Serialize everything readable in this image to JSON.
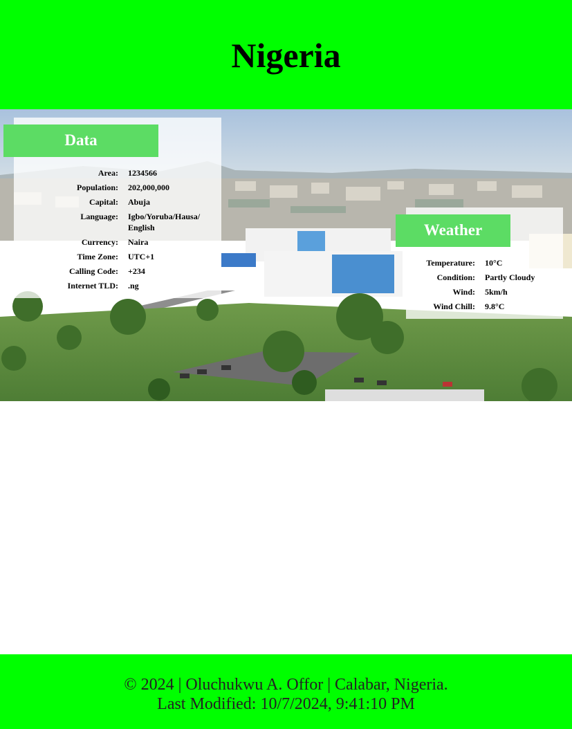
{
  "page": {
    "title": "Nigeria"
  },
  "hero": {
    "image_alt": "Aerial view of Abuja cityscape"
  },
  "data_card": {
    "title": "Data",
    "rows": [
      {
        "label": "Area:",
        "value": "1234566"
      },
      {
        "label": "Population:",
        "value": "202,000,000"
      },
      {
        "label": "Capital:",
        "value": "Abuja"
      },
      {
        "label": "Language:",
        "value": "Igbo/Yoruba/Hausa/ English"
      },
      {
        "label": "Currency:",
        "value": "Naira"
      },
      {
        "label": "Time Zone:",
        "value": "UTC+1"
      },
      {
        "label": "Calling Code:",
        "value": "+234"
      },
      {
        "label": "Internet TLD:",
        "value": ".ng"
      }
    ]
  },
  "weather_card": {
    "title": "Weather",
    "rows": [
      {
        "label": "Temperature:",
        "value": "10°C"
      },
      {
        "label": "Condition:",
        "value": "Partly Cloudy"
      },
      {
        "label": "Wind:",
        "value": "5km/h"
      },
      {
        "label": "Wind Chill:",
        "value": "9.8°C"
      }
    ]
  },
  "footer": {
    "copyright": "© 2024 | Oluchukwu A. Offor | Calabar, Nigeria.",
    "last_modified": "Last Modified: 10/7/2024, 9:41:10 PM"
  },
  "colors": {
    "header_bg": "#00ff00",
    "footer_bg": "#00ff00",
    "card_title_bg": "#5cdc64"
  }
}
